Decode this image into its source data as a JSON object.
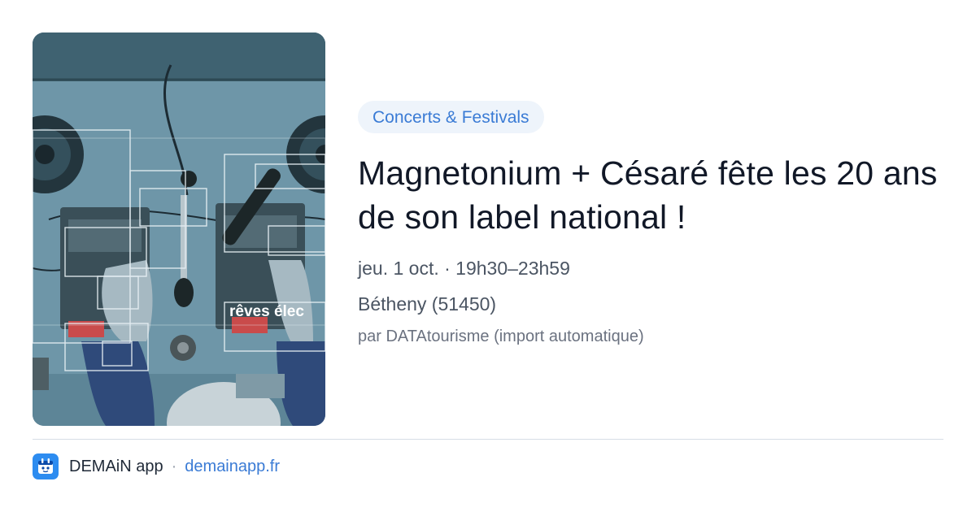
{
  "event": {
    "category": "Concerts & Festivals",
    "title": "Magnetonium + Césaré fête les 20 ans de son label national !",
    "date_time": "jeu. 1 oct. · 19h30–23h59",
    "location": "Bétheny (51450)",
    "source": "par DATAtourisme (import automatique)",
    "image": {
      "overlay_text": "rêves élec",
      "description_icon": "event-photo"
    }
  },
  "footer": {
    "app_name": "DEMAiN app",
    "separator": "·",
    "domain": "demainapp.fr"
  },
  "colors": {
    "accent": "#3a7bd5",
    "category_bg": "#eef4fb",
    "app_icon": "#2d8cf0"
  }
}
